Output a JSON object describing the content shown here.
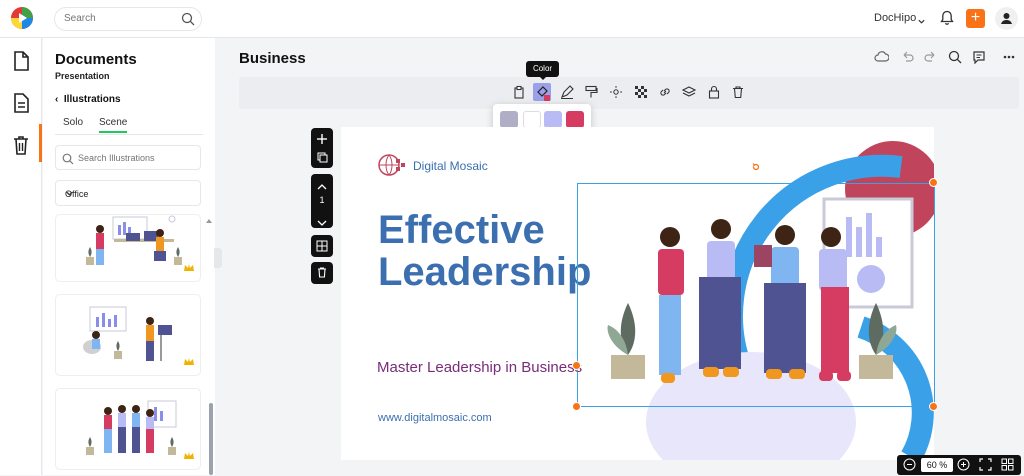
{
  "topbar": {
    "search_placeholder": "Search",
    "brand": "DocHipo",
    "plus": "+"
  },
  "panel": {
    "title": "Documents",
    "subtitle": "Presentation",
    "back_label": "Illustrations",
    "tabs": [
      "Solo",
      "Scene"
    ],
    "selected_tab": "Scene",
    "search_placeholder": "Search Illustrations",
    "category": "Office",
    "premium_icon": "crown-icon"
  },
  "editor": {
    "doc_title": "Business",
    "tooltip": "Color",
    "page_number": "1",
    "zoom": "60",
    "zoom_unit": "%"
  },
  "palette": {
    "colors": [
      "#b0aec6",
      "#ffffff",
      "#b9bcf4",
      "#d63b61",
      "#8ea895",
      "#5d6b60",
      "#c4b89a",
      "#8a8ee8",
      "#3d2415",
      "#eba888",
      "#f0971f",
      "#9c4563",
      "#7fb6f2",
      "#e97a9a",
      "#d0d0d0",
      "#505391"
    ]
  },
  "slide": {
    "brand": "Digital Mosaic",
    "headline_1": "Effective",
    "headline_2": "Leadership",
    "tagline": "Master Leadership in Business",
    "url": "www.digitalmosaic.com"
  },
  "colors": {
    "accent": "#f97316",
    "heading": "#3b6fb0",
    "tagline": "#7a2b7a",
    "selection": "#3aa0e8"
  }
}
